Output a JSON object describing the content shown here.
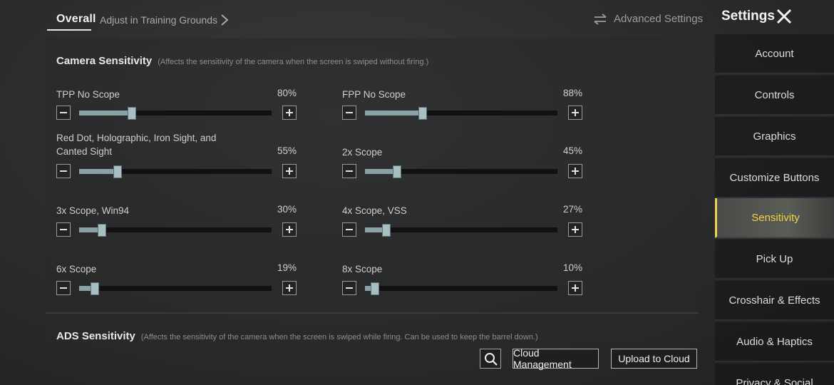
{
  "header": {
    "tabs": [
      {
        "label": "Overall",
        "active": true
      },
      {
        "label": "Adjust in Training Grounds",
        "active": false
      }
    ],
    "advanced_settings_label": "Advanced Settings",
    "settings_title": "Settings"
  },
  "sidebar": {
    "items": [
      {
        "label": "Account"
      },
      {
        "label": "Controls"
      },
      {
        "label": "Graphics"
      },
      {
        "label": "Customize Buttons"
      },
      {
        "label": "Sensitivity",
        "active": true
      },
      {
        "label": "Pick Up"
      },
      {
        "label": "Crosshair & Effects"
      },
      {
        "label": "Audio & Haptics"
      },
      {
        "label": "Privacy & Social"
      }
    ],
    "accent_color": "#f0d24a"
  },
  "camera_section": {
    "title": "Camera Sensitivity",
    "note": "(Affects the sensitivity of the camera when the screen is swiped without firing.)",
    "sliders": [
      {
        "label": "TPP No Scope",
        "value_text": "80%",
        "level": 0.275
      },
      {
        "label": "FPP No Scope",
        "value_text": "88%",
        "level": 0.3
      },
      {
        "label": "Red Dot, Holographic, Iron Sight, and Canted Sight",
        "value_text": "55%",
        "level": 0.2
      },
      {
        "label": "2x Scope",
        "value_text": "45%",
        "level": 0.165
      },
      {
        "label": "3x Scope, Win94",
        "value_text": "30%",
        "level": 0.12
      },
      {
        "label": "4x Scope, VSS",
        "value_text": "27%",
        "level": 0.11
      },
      {
        "label": "6x Scope",
        "value_text": "19%",
        "level": 0.08
      },
      {
        "label": "8x Scope",
        "value_text": "10%",
        "level": 0.05
      }
    ]
  },
  "ads_section": {
    "title": "ADS Sensitivity",
    "note": "(Affects the sensitivity of the camera when the screen is swiped while firing. Can be used to keep the barrel down.)"
  },
  "footer": {
    "cloud_management_label": "Cloud Management",
    "upload_label": "Upload to Cloud"
  },
  "colors": {
    "slider_fill": "#8aa1a6",
    "slider_knob": "#a7bfc3"
  }
}
